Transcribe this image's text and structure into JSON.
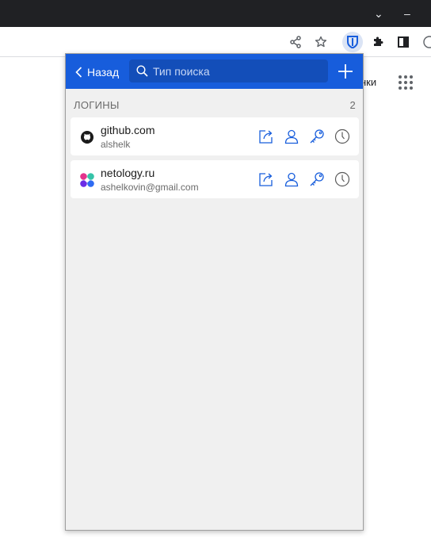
{
  "browser": {
    "chevron_glyph": "⌄",
    "minimize_glyph": "–",
    "bg_link_fragment": "нки"
  },
  "popup": {
    "header": {
      "back_label": "Назад",
      "search_placeholder": "Тип поиска",
      "accent_color": "#175ddc"
    },
    "section": {
      "title": "ЛОГИНЫ",
      "count": "2"
    },
    "items": [
      {
        "name": "github.com",
        "username": "alshelk",
        "icon": "github-icon"
      },
      {
        "name": "netology.ru",
        "username": "ashelkovin@gmail.com",
        "icon": "netology-icon"
      }
    ],
    "item_actions": [
      "launch-icon",
      "copy-username-icon",
      "copy-password-icon",
      "history-icon"
    ]
  }
}
